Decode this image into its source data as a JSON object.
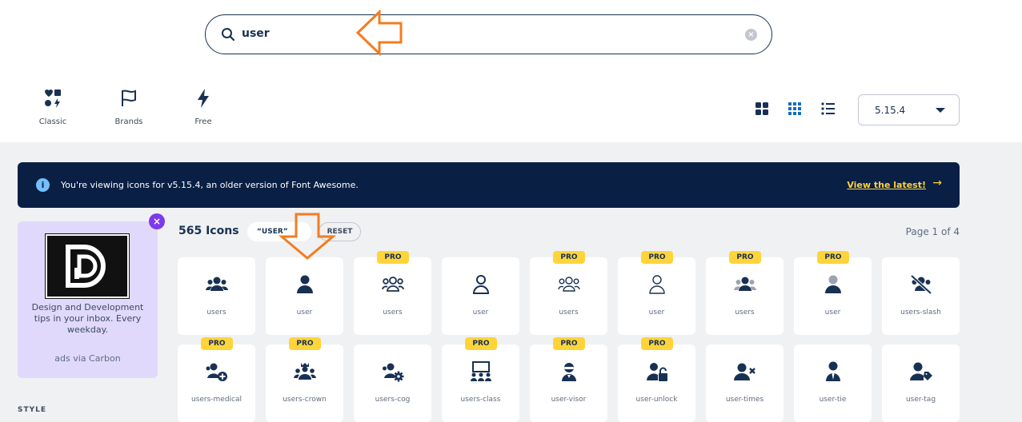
{
  "search": {
    "query": "user",
    "clear_label": "×"
  },
  "families": [
    {
      "label": "Classic",
      "icon": "classic-icon"
    },
    {
      "label": "Brands",
      "icon": "flag-icon"
    },
    {
      "label": "Free",
      "icon": "bolt-icon"
    }
  ],
  "view_toggles": [
    "grid-large-icon",
    "grid-small-icon",
    "list-icon"
  ],
  "version": {
    "selected": "5.15.4"
  },
  "banner": {
    "info_icon": "i",
    "message": "You're viewing icons for v5.15.4, an older version of Font Awesome.",
    "link": "View the latest!",
    "arrow": "→"
  },
  "ad": {
    "copy": "Design and Development tips in your inbox. Every weekday.",
    "via": "ads via Carbon",
    "close": "×"
  },
  "sidebar": {
    "style_label": "STYLE"
  },
  "results": {
    "count": "565 Icons",
    "filter_chip": "“USER”",
    "reset": "RESET",
    "page": "Page 1 of 4"
  },
  "pro_label": "PRO",
  "icons_row1": [
    {
      "name": "users",
      "pro": false,
      "icon": "users-solid-icon"
    },
    {
      "name": "user",
      "pro": false,
      "icon": "user-solid-icon"
    },
    {
      "name": "users",
      "pro": true,
      "icon": "users-outline-icon"
    },
    {
      "name": "user",
      "pro": false,
      "icon": "user-outline-icon"
    },
    {
      "name": "users",
      "pro": true,
      "icon": "users-light-icon"
    },
    {
      "name": "user",
      "pro": true,
      "icon": "user-light-icon"
    },
    {
      "name": "users",
      "pro": true,
      "icon": "users-duotone-icon"
    },
    {
      "name": "user",
      "pro": true,
      "icon": "user-duotone-icon"
    },
    {
      "name": "users-slash",
      "pro": false,
      "icon": "users-slash-icon"
    }
  ],
  "icons_row2": [
    {
      "name": "users-medical",
      "pro": true,
      "icon": "users-medical-icon"
    },
    {
      "name": "users-crown",
      "pro": true,
      "icon": "users-crown-icon"
    },
    {
      "name": "users-cog",
      "pro": false,
      "icon": "users-cog-icon"
    },
    {
      "name": "users-class",
      "pro": true,
      "icon": "users-class-icon"
    },
    {
      "name": "user-visor",
      "pro": true,
      "icon": "user-visor-icon"
    },
    {
      "name": "user-unlock",
      "pro": true,
      "icon": "user-unlock-icon"
    },
    {
      "name": "user-times",
      "pro": false,
      "icon": "user-times-icon"
    },
    {
      "name": "user-tie",
      "pro": false,
      "icon": "user-tie-icon"
    },
    {
      "name": "user-tag",
      "pro": false,
      "icon": "user-tag-icon"
    }
  ],
  "colors": {
    "navy": "#183153",
    "banner": "#0a1f44",
    "pro": "#ffd43b",
    "ad_bg": "#e0d9fb",
    "annotation": "#f47c20"
  }
}
